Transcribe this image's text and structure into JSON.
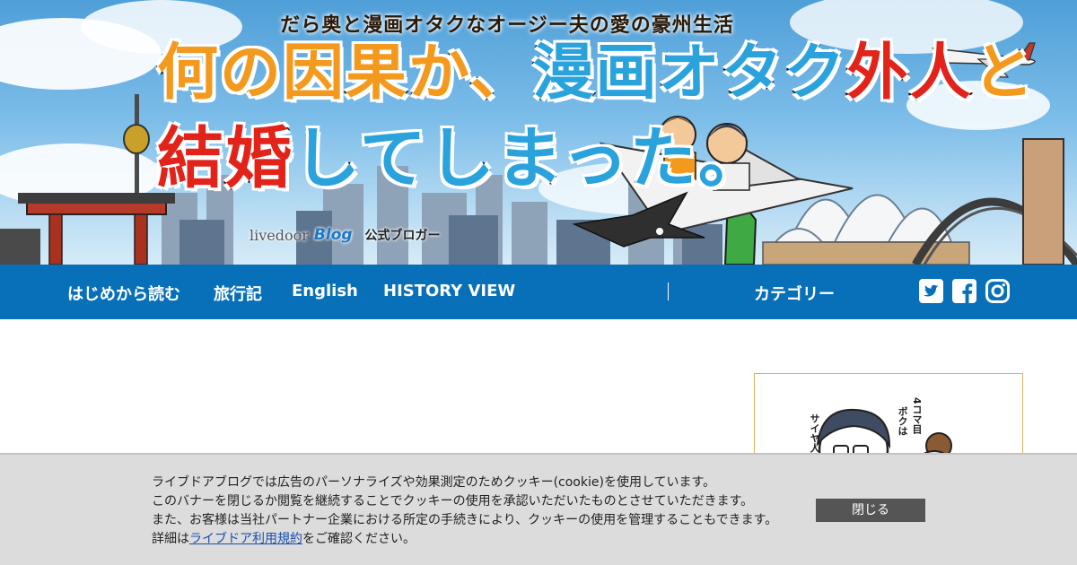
{
  "banner": {
    "tagline": "だら奥と漫画オタクなオージー夫の愛の豪州生活",
    "title_part1": "何の因果か、",
    "title_part2": "漫画オタク",
    "title_part3": "外人",
    "title_part4": "と",
    "title_line2_part1": "結婚",
    "title_line2_part2": "してしまった。",
    "badge_livedoor": "livedoor",
    "badge_blog": "Blog",
    "badge_official": "公式ブロガー"
  },
  "nav": {
    "items": [
      {
        "label": "はじめから読む"
      },
      {
        "label": "旅行記"
      },
      {
        "label": "English"
      },
      {
        "label": "HISTORY VIEW"
      }
    ],
    "category_label": "カテゴリー",
    "social": [
      {
        "icon": "twitter-icon"
      },
      {
        "icon": "facebook-icon"
      },
      {
        "icon": "instagram-icon"
      }
    ],
    "colors": {
      "bar": "#0870b8",
      "text": "#ffffff"
    }
  },
  "sidebar": {
    "comic_text_1": "4コマ目",
    "comic_text_2": "ボクは",
    "comic_text_3": "サイヤ人"
  },
  "cookie": {
    "line1": "ライブドアブログでは広告のパーソナライズや効果測定のためクッキー(cookie)を使用しています。",
    "line2": "このバナーを閉じるか閲覧を継続することでクッキーの使用を承認いただいたものとさせていただきます。",
    "line3": "また、お客様は当社パートナー企業における所定の手続きにより、クッキーの使用を管理することもできます。",
    "line4_prefix": "詳細は",
    "line4_link": "ライブドア利用規約",
    "line4_suffix": "をご確認ください。",
    "close_label": "閉じる"
  }
}
